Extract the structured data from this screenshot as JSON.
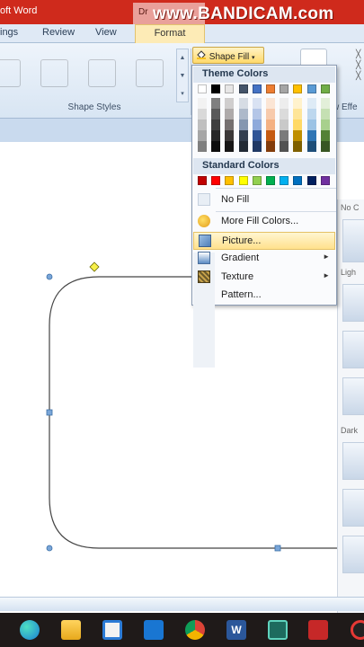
{
  "window": {
    "title_fragment": "oft Word",
    "context_tab_title": "Dr",
    "watermark": "www.BANDICAM.com"
  },
  "tabs": [
    {
      "label": "ings"
    },
    {
      "label": "Review"
    },
    {
      "label": "View"
    },
    {
      "label": "Format",
      "active": true
    }
  ],
  "ribbon": {
    "shape_styles_label": "Shape Styles",
    "swatch_colors": [
      "#8f8f8f",
      "#f8c21c",
      "#5b9bd5",
      "#70ad47"
    ],
    "shape_fill_label": "Shape Fill",
    "effects_label": "w Effe"
  },
  "shape_fill_menu": {
    "theme_colors_header": "Theme Colors",
    "theme_top_row": [
      "#ffffff",
      "#000000",
      "#e7e6e6",
      "#44546a",
      "#4472c4",
      "#ed7d31",
      "#a5a5a5",
      "#ffc000",
      "#5b9bd5",
      "#70ad47"
    ],
    "theme_shade_columns": [
      [
        "#f2f2f2",
        "#d9d9d9",
        "#bfbfbf",
        "#a6a6a6",
        "#7f7f7f"
      ],
      [
        "#7f7f7f",
        "#595959",
        "#3f3f3f",
        "#262626",
        "#0d0d0d"
      ],
      [
        "#d0cece",
        "#aeaaaa",
        "#757070",
        "#3b3838",
        "#171616"
      ],
      [
        "#d6dce4",
        "#adb9ca",
        "#8496b0",
        "#333f50",
        "#222a35"
      ],
      [
        "#d9e2f3",
        "#b4c6e7",
        "#8eaadb",
        "#2f5496",
        "#1f3864"
      ],
      [
        "#fbe5d5",
        "#f7caac",
        "#f4b183",
        "#c55a11",
        "#833c0b"
      ],
      [
        "#ededed",
        "#dbdbdb",
        "#c9c9c9",
        "#7b7b7b",
        "#525252"
      ],
      [
        "#fff2cc",
        "#fee599",
        "#ffd965",
        "#bf8f00",
        "#7f6000"
      ],
      [
        "#deebf6",
        "#bdd7ee",
        "#9cc3e5",
        "#2e75b5",
        "#1e4e79"
      ],
      [
        "#e2efd9",
        "#c5e0b3",
        "#a8d08d",
        "#538135",
        "#375623"
      ]
    ],
    "standard_colors_header": "Standard Colors",
    "standard_colors": [
      "#c00000",
      "#ff0000",
      "#ffc000",
      "#ffff00",
      "#92d050",
      "#00b050",
      "#00b0f0",
      "#0070c0",
      "#002060",
      "#7030a0"
    ],
    "items": [
      {
        "label": "No Fill",
        "submenu": false
      },
      {
        "label": "More Fill Colors...",
        "submenu": false
      },
      {
        "label": "Picture...",
        "submenu": false,
        "highlighted": true
      },
      {
        "label": "Gradient",
        "submenu": true
      },
      {
        "label": "Texture",
        "submenu": true
      },
      {
        "label": "Pattern...",
        "submenu": false
      }
    ]
  },
  "side_panel": {
    "labels": [
      "No C",
      "Ligh",
      "Dark"
    ]
  },
  "taskbar": {
    "icons": [
      "edge-icon",
      "file-explorer-icon",
      "store-icon",
      "mail-icon",
      "chrome-icon",
      "word-icon",
      "app-icon",
      "screen-icon"
    ]
  }
}
